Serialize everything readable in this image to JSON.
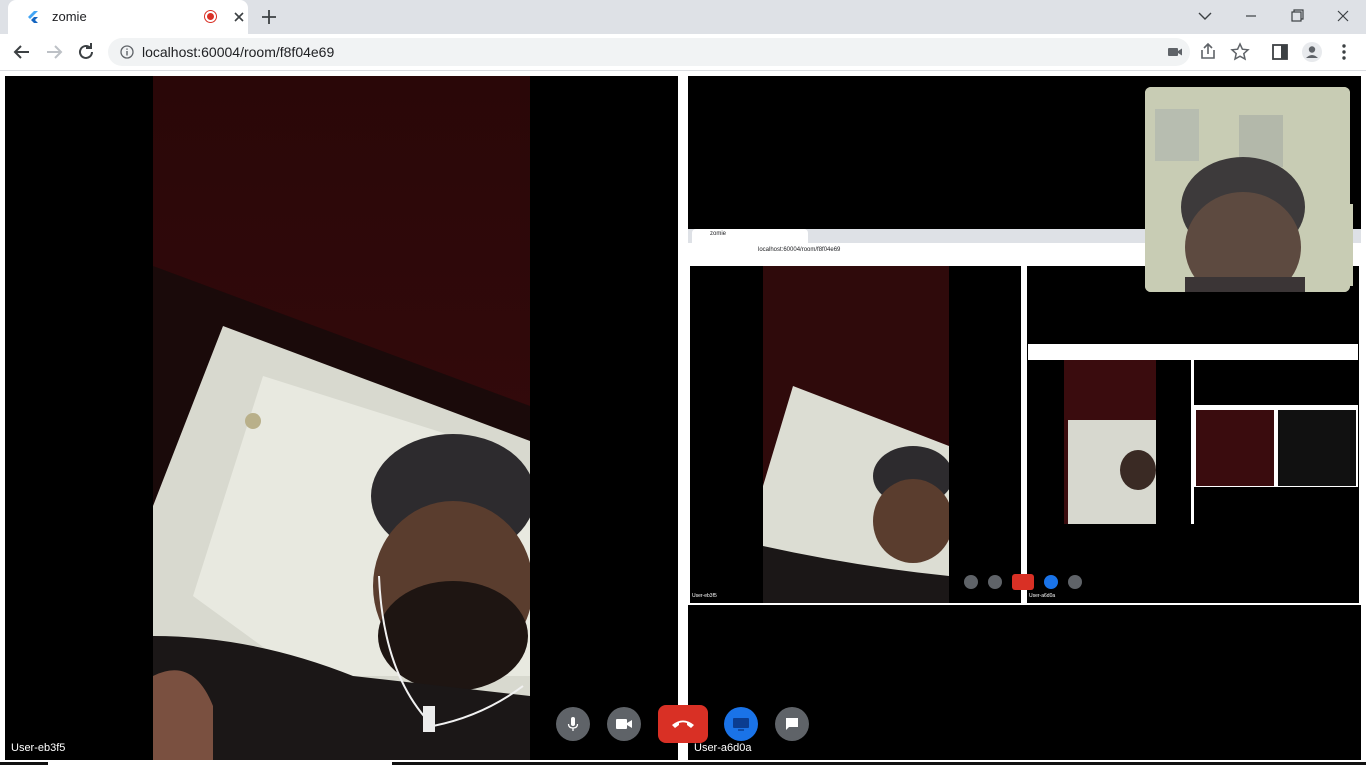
{
  "browser": {
    "tab_title": "zomie",
    "url": "localhost:60004/room/f8f04e69"
  },
  "room": {
    "participants": [
      {
        "label": "User-eb3f5"
      },
      {
        "label": "User-a6d0a"
      }
    ],
    "nested_screenshot": {
      "tab_title": "zomie",
      "url": "localhost:60004/room/f8f04e69",
      "left_label": "User-eb3f5",
      "right_label": "User-a6d0a"
    },
    "controls": {
      "mic_icon": "mic-icon",
      "camera_icon": "camera-icon",
      "end_call_icon": "phone-hangup-icon",
      "share_icon": "screen-share-icon",
      "chat_icon": "chat-icon"
    }
  },
  "colors": {
    "end_call": "#d93025",
    "share": "#1a73e8",
    "control": "#5f6368",
    "tile_bg": "#000000"
  }
}
